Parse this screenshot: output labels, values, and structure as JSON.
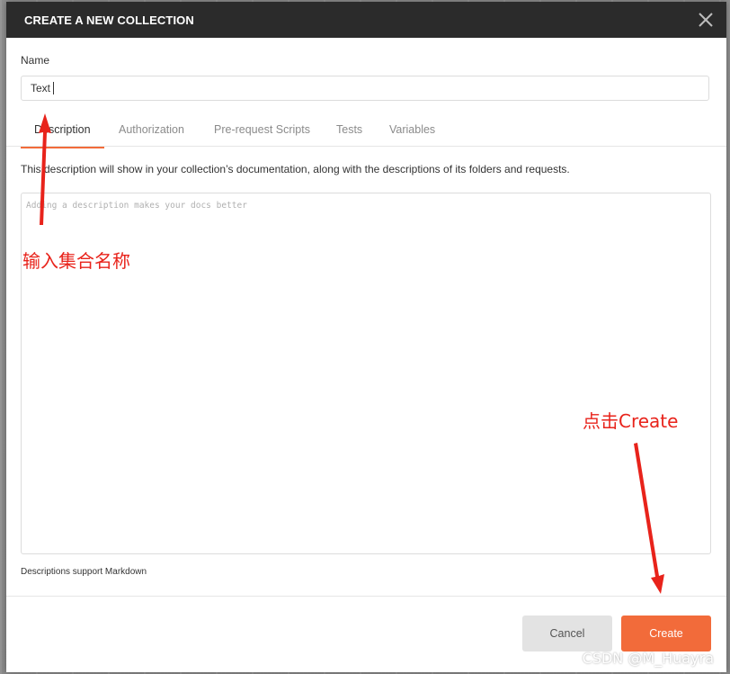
{
  "dialog": {
    "title": "CREATE A NEW COLLECTION"
  },
  "name_field": {
    "label": "Name",
    "value": "Text"
  },
  "tabs": [
    {
      "label": "Description",
      "active": true
    },
    {
      "label": "Authorization",
      "active": false
    },
    {
      "label": "Pre-request Scripts",
      "active": false
    },
    {
      "label": "Tests",
      "active": false
    },
    {
      "label": "Variables",
      "active": false
    }
  ],
  "description": {
    "info": "This description will show in your collection’s documentation, along with the descriptions of its folders and requests.",
    "placeholder": "Adding a description makes your docs better",
    "markdown_note": "Descriptions support Markdown"
  },
  "buttons": {
    "cancel": "Cancel",
    "create": "Create"
  },
  "annotations": {
    "name_hint": "输入集合名称",
    "create_hint": "点击Create",
    "color": "#e8231b"
  },
  "watermark": "CSDN @M_Huayra",
  "colors": {
    "accent": "#f26b3a",
    "header_bg": "#2b2b2b"
  }
}
